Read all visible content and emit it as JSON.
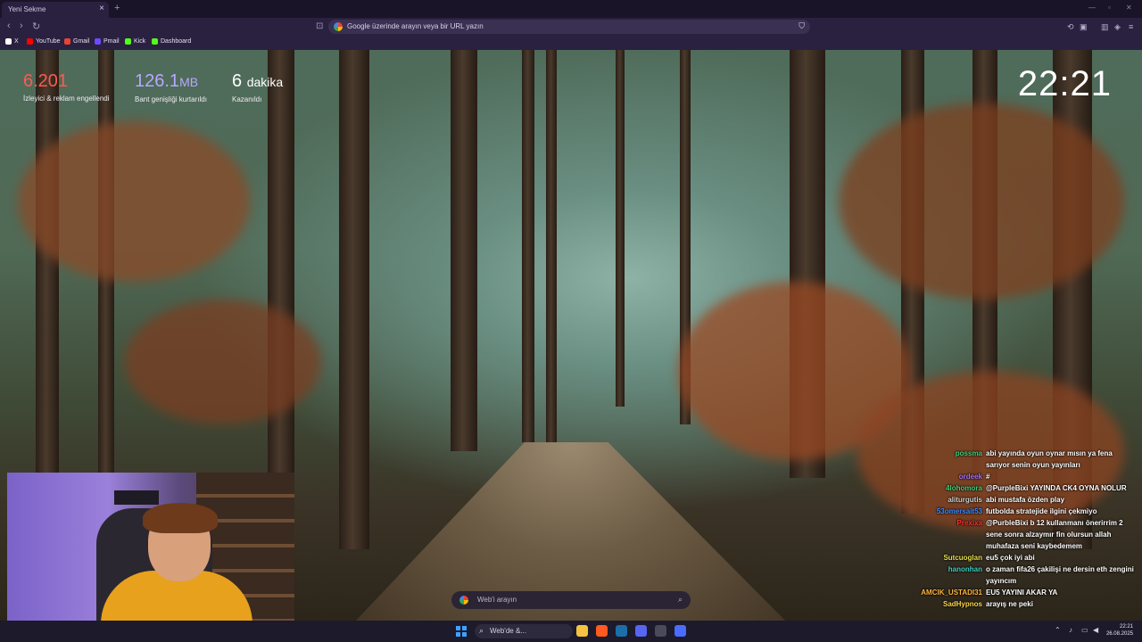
{
  "browser": {
    "tab_title": "Yeni Sekme",
    "close_glyph": "×",
    "new_tab_glyph": "+",
    "omnibox_placeholder": "Google üzerinde arayın veya bir URL yazın",
    "bookmarks": [
      {
        "label": "X",
        "icon": "x-icon",
        "color": "#ffffff"
      },
      {
        "label": "YouTube",
        "icon": "youtube-icon",
        "color": "#ff0000"
      },
      {
        "label": "Gmail",
        "icon": "gmail-icon",
        "color": "#ea4335"
      },
      {
        "label": "Pmail",
        "icon": "proton-mail-icon",
        "color": "#6d4aff"
      },
      {
        "label": "Kick",
        "icon": "kick-icon",
        "color": "#53fc18"
      },
      {
        "label": "Dashboard",
        "icon": "dashboard-icon",
        "color": "#53fc18"
      }
    ]
  },
  "stats": [
    {
      "value": "6.201",
      "unit": "",
      "label": "İzleyici & reklam engellendi",
      "color": "#ff5a4f"
    },
    {
      "value": "126.1",
      "unit": "MB",
      "label": "Bant genişliği kurtarıldı",
      "color": "#b7a8ff"
    },
    {
      "value": "6",
      "unit": "dakika",
      "label": "Kazanıldı",
      "color": "#ffffff"
    }
  ],
  "clock": "22:21",
  "search": {
    "placeholder": "Web'i arayın"
  },
  "chat": [
    {
      "user": "possma",
      "color": "#3fd07a",
      "text": "abi yayında oyun oynar mısın ya fena sarıyor senin oyun yayınları"
    },
    {
      "user": "ordeek",
      "color": "#a970ff",
      "text": "#"
    },
    {
      "user": "4lohomora",
      "color": "#3fd07a",
      "text": "@PurpleBixi YAYINDA CK4 OYNA NOLUR"
    },
    {
      "user": "aliturgutis",
      "color": "#d2d2d2",
      "text": "abi mustafa özden play"
    },
    {
      "user": "53omersait53",
      "color": "#3b8cff",
      "text": "futbolda stratejide ilgini çekmiyo"
    },
    {
      "user": "Prexixa",
      "color": "#ff3030",
      "text": "@PurbleBixi b 12 kullanmanı önerirrim 2 sene sonra alzaymır fin olursun allah muhafaza seni kaybedemem"
    },
    {
      "user": "Sutcuoglan",
      "color": "#e5e04a",
      "text": "eu5 çok iyi abi"
    },
    {
      "user": "hanonhan",
      "color": "#3fd0c0",
      "text": "o zaman fifa26 çakilişi ne dersin eth zengini yayıncım"
    },
    {
      "user": "AMCIK_USTADI31",
      "color": "#ffb640",
      "text": "EU5 YAYINI AKAR YA"
    },
    {
      "user": "SadHypnos",
      "color": "#ffd84a",
      "text": "arayış ne peki"
    }
  ],
  "taskbar": {
    "search_placeholder": "Web'de &...",
    "apps": [
      {
        "icon": "file-explorer-icon",
        "color": "#f5c242"
      },
      {
        "icon": "brave-browser-icon",
        "color": "#ff5a1f"
      },
      {
        "icon": "steam-icon",
        "color": "#1b6ea8"
      },
      {
        "icon": "discord-icon",
        "color": "#5865f2"
      },
      {
        "icon": "obs-icon",
        "color": "#4a4a5a"
      },
      {
        "icon": "app-icon",
        "color": "#4a6cff"
      }
    ],
    "time": "22:21",
    "date": "26.08.2025"
  }
}
